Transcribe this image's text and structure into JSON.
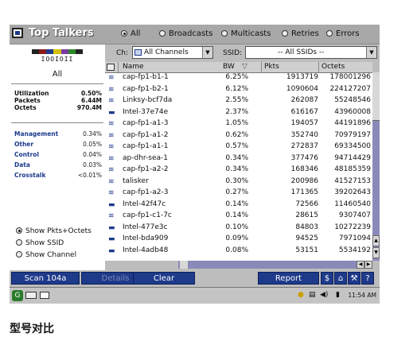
{
  "window": {
    "title": "Top Talkers"
  },
  "filters": [
    {
      "label": "All",
      "selected": true
    },
    {
      "label": "Broadcasts",
      "selected": false
    },
    {
      "label": "Multicasts",
      "selected": false
    },
    {
      "label": "Retries",
      "selected": false
    },
    {
      "label": "Errors",
      "selected": false
    }
  ],
  "left": {
    "ap_code": "IOOIOII",
    "scope_label": "All",
    "stats": [
      {
        "label": "Utilization",
        "value": "0.50%"
      },
      {
        "label": "Packets",
        "value": "6.44M"
      },
      {
        "label": "Octets",
        "value": "970.4M"
      }
    ],
    "categories": [
      {
        "label": "Management",
        "value": "0.34%"
      },
      {
        "label": "Other",
        "value": "0.05%"
      },
      {
        "label": "Control",
        "value": "0.04%"
      },
      {
        "label": "Data",
        "value": "0.03%"
      },
      {
        "label": "Crosstalk",
        "value": "<0.01%"
      }
    ],
    "show_options": [
      {
        "label": "Show Pkts+Octets",
        "selected": true
      },
      {
        "label": "Show SSID",
        "selected": false
      },
      {
        "label": "Show Channel",
        "selected": false
      }
    ],
    "colorbar": [
      "#222222",
      "#8b1a1a",
      "#1e3a8a",
      "#d4c000",
      "#7a3aa0",
      "#2a8a2a",
      "#222222"
    ]
  },
  "channel": {
    "label": "Ch:",
    "value": "All Channels"
  },
  "ssid": {
    "label": "SSID:",
    "value": "-- All SSIDs --"
  },
  "table": {
    "headers": {
      "name": "Name",
      "bw": "BW",
      "pkts": "Pkts",
      "octets": "Octets"
    },
    "rows": [
      {
        "icon": "ap",
        "name": "cap-fp1-b1-1",
        "bw": "6.25%",
        "pkts": "1913719",
        "octets": "178001296"
      },
      {
        "icon": "ap",
        "name": "cap-fp1-b2-1",
        "bw": "6.12%",
        "pkts": "1090604",
        "octets": "224127207"
      },
      {
        "icon": "ap",
        "name": "Linksy-bcf7da",
        "bw": "2.55%",
        "pkts": "262087",
        "octets": "55248546"
      },
      {
        "icon": "client",
        "name": "Intel-37e74e",
        "bw": "2.37%",
        "pkts": "616167",
        "octets": "43960008"
      },
      {
        "icon": "ap",
        "name": "cap-fp1-a1-3",
        "bw": "1.05%",
        "pkts": "194057",
        "octets": "44191896"
      },
      {
        "icon": "ap",
        "name": "cap-fp1-a1-2",
        "bw": "0.62%",
        "pkts": "352740",
        "octets": "70979197"
      },
      {
        "icon": "ap",
        "name": "cap-fp1-a1-1",
        "bw": "0.57%",
        "pkts": "272837",
        "octets": "69334500"
      },
      {
        "icon": "ap",
        "name": "ap-dhr-sea-1",
        "bw": "0.34%",
        "pkts": "377476",
        "octets": "94714429"
      },
      {
        "icon": "ap",
        "name": "cap-fp1-a2-2",
        "bw": "0.34%",
        "pkts": "168346",
        "octets": "48185359"
      },
      {
        "icon": "ap",
        "name": "talisker",
        "bw": "0.30%",
        "pkts": "200986",
        "octets": "41527153"
      },
      {
        "icon": "ap",
        "name": "cap-fp1-a2-3",
        "bw": "0.27%",
        "pkts": "171365",
        "octets": "39202643"
      },
      {
        "icon": "client",
        "name": "Intel-42f47c",
        "bw": "0.14%",
        "pkts": "72566",
        "octets": "11460540"
      },
      {
        "icon": "ap",
        "name": "cap-fp1-c1-7c",
        "bw": "0.14%",
        "pkts": "28615",
        "octets": "9307407"
      },
      {
        "icon": "client",
        "name": "Intel-477e3c",
        "bw": "0.10%",
        "pkts": "84803",
        "octets": "10272239"
      },
      {
        "icon": "client",
        "name": "Intel-bda909",
        "bw": "0.09%",
        "pkts": "94525",
        "octets": "7971094"
      },
      {
        "icon": "client",
        "name": "Intel-4adb48",
        "bw": "0.08%",
        "pkts": "53151",
        "octets": "5534192"
      }
    ]
  },
  "buttons": {
    "scan": "Scan 104a",
    "details": "Details",
    "clear": "Clear",
    "report": "Report",
    "help": "?"
  },
  "taskbar": {
    "time": "11:54 AM"
  },
  "caption": "型号对比"
}
